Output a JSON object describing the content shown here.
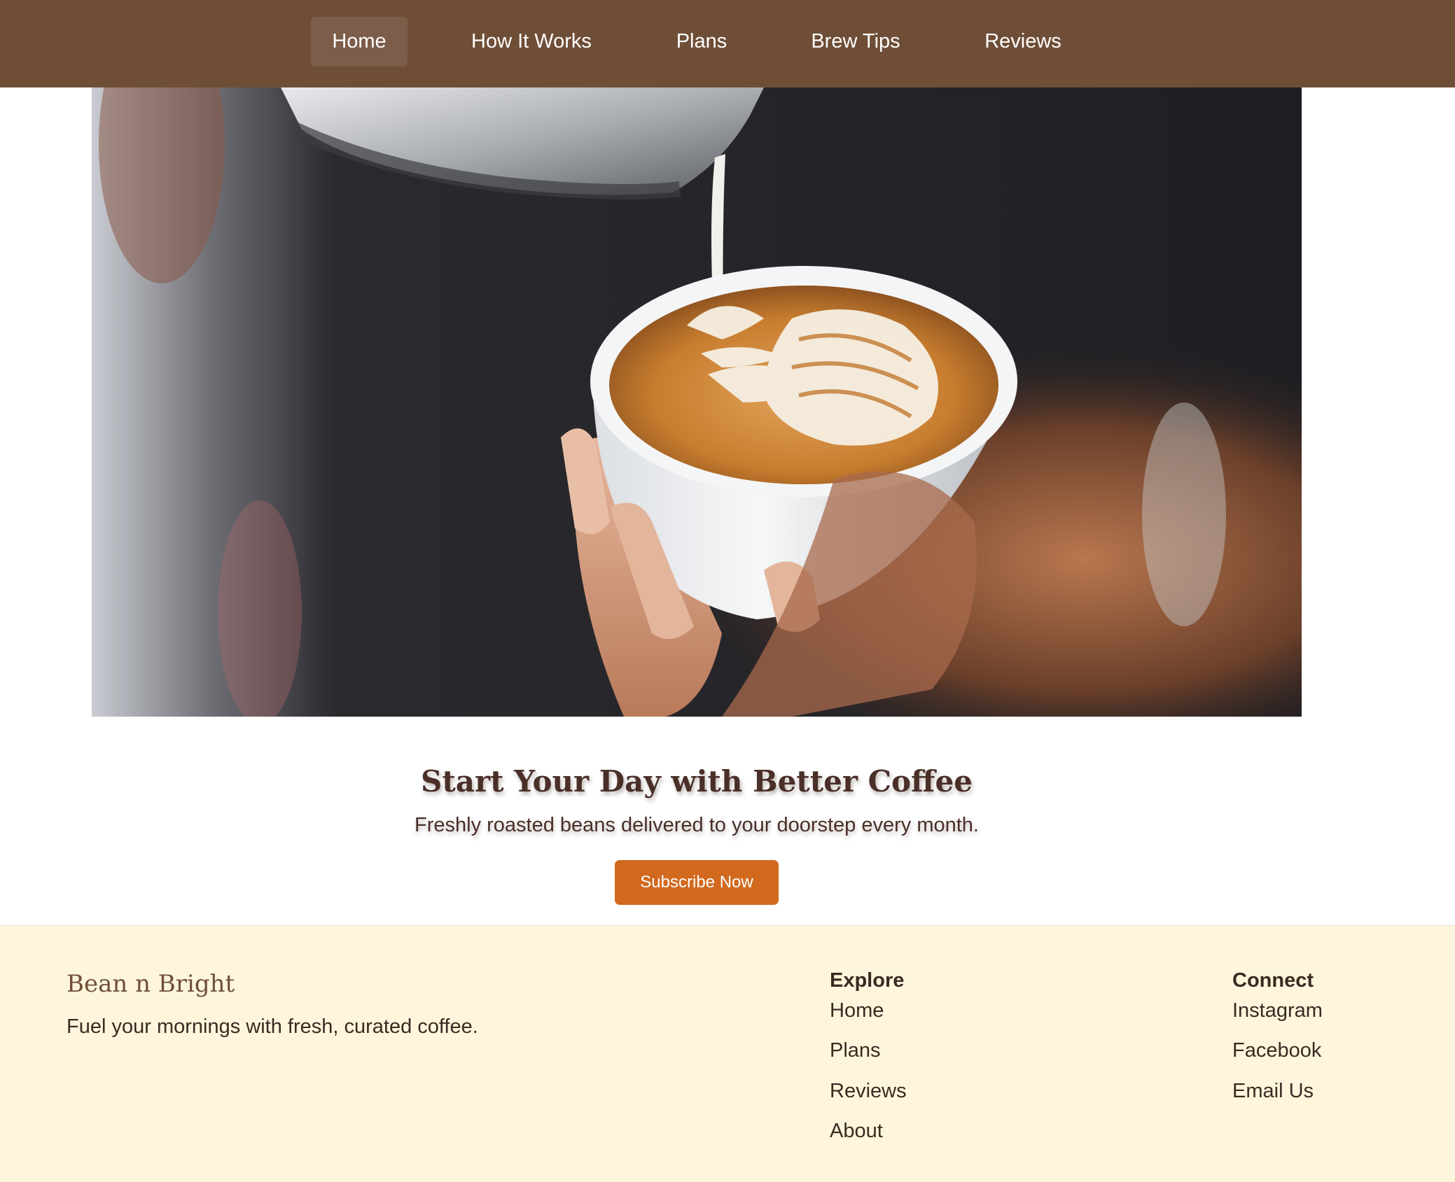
{
  "nav": {
    "items": [
      {
        "label": "Home",
        "active": true
      },
      {
        "label": "How It Works",
        "active": false
      },
      {
        "label": "Plans",
        "active": false
      },
      {
        "label": "Brew Tips",
        "active": false
      },
      {
        "label": "Reviews",
        "active": false
      }
    ]
  },
  "hero": {
    "image_subject": "latte art pour into white cup",
    "title": "Start Your Day with Better Coffee",
    "subtitle": "Freshly roasted beans delivered to your doorstep every month.",
    "cta_label": "Subscribe Now"
  },
  "footer": {
    "brand": "Bean n Bright",
    "tagline": "Fuel your mornings with fresh, curated coffee.",
    "explore": {
      "heading": "Explore",
      "links": [
        "Home",
        "Plans",
        "Reviews",
        "About"
      ]
    },
    "connect": {
      "heading": "Connect",
      "links": [
        "Instagram",
        "Facebook",
        "Email Us"
      ]
    }
  },
  "colors": {
    "nav_bg": "#6f4e37",
    "cta_bg": "#d2691e",
    "footer_bg": "#fdf6dc",
    "heading_text": "#4a2f28"
  }
}
